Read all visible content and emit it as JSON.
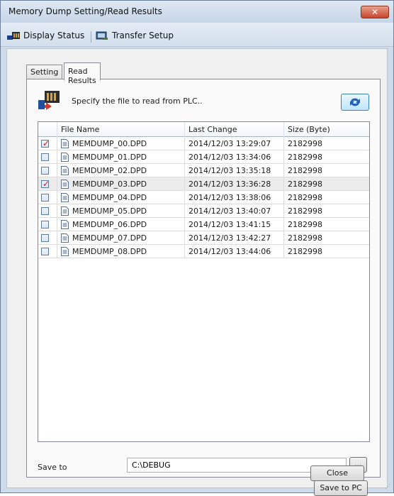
{
  "window": {
    "title": "Memory Dump Setting/Read Results",
    "close_label": "✕"
  },
  "menu": {
    "display_status": "Display Status",
    "transfer_setup": "Transfer Setup"
  },
  "tabs": [
    {
      "label": "Setting",
      "active": false
    },
    {
      "label": "Read Results",
      "active": true
    }
  ],
  "panel": {
    "instruction": "Specify the file to read from PLC..",
    "columns": [
      "File Name",
      "Last Change",
      "Size (Byte)"
    ],
    "files": [
      {
        "checked": true,
        "name": "MEMDUMP_00.DPD",
        "last_change": "2014/12/03 13:29:07",
        "size": "2182998"
      },
      {
        "checked": false,
        "name": "MEMDUMP_01.DPD",
        "last_change": "2014/12/03 13:34:06",
        "size": "2182998"
      },
      {
        "checked": false,
        "name": "MEMDUMP_02.DPD",
        "last_change": "2014/12/03 13:35:18",
        "size": "2182998"
      },
      {
        "checked": true,
        "name": "MEMDUMP_03.DPD",
        "last_change": "2014/12/03 13:36:28",
        "size": "2182998"
      },
      {
        "checked": false,
        "name": "MEMDUMP_04.DPD",
        "last_change": "2014/12/03 13:38:06",
        "size": "2182998"
      },
      {
        "checked": false,
        "name": "MEMDUMP_05.DPD",
        "last_change": "2014/12/03 13:40:07",
        "size": "2182998"
      },
      {
        "checked": false,
        "name": "MEMDUMP_06.DPD",
        "last_change": "2014/12/03 13:41:15",
        "size": "2182998"
      },
      {
        "checked": false,
        "name": "MEMDUMP_07.DPD",
        "last_change": "2014/12/03 13:42:27",
        "size": "2182998"
      },
      {
        "checked": false,
        "name": "MEMDUMP_08.DPD",
        "last_change": "2014/12/03 13:44:06",
        "size": "2182998"
      }
    ],
    "save_to_label": "Save to",
    "save_to_path": "C:\\DEBUG",
    "browse_label": "...",
    "save_pc_label": "Save to PC"
  },
  "footer": {
    "close_label": "Close"
  }
}
